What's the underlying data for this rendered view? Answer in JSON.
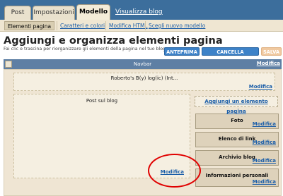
{
  "top_tabs": [
    {
      "label": "Post",
      "active": false
    },
    {
      "label": "Impostazioni",
      "active": false
    },
    {
      "label": "Modello",
      "active": true
    }
  ],
  "view_blog_link": "Visualizza blog",
  "sub_tabs": [
    {
      "label": "Elementi pagina",
      "active": true
    },
    {
      "label": "Caratteri e colori",
      "active": false
    },
    {
      "label": "Modifica HTML",
      "active": false
    },
    {
      "label": "Scegli nuovo modello",
      "active": false
    }
  ],
  "page": {
    "title": "Aggiungi e organizza elementi pagina",
    "subtitle": "Fai clic e trascina per riorganizzare gli elementi della pagina nel tuo blog."
  },
  "buttons": {
    "preview": "ANTEPRIMA",
    "clear": "CANCELLA MODIFICHE",
    "save": "SALVA"
  },
  "navbar": {
    "title": "Navbar",
    "edit": "Modifica"
  },
  "header_box": {
    "title": "Roberto's B(y) log(ic) (Int...",
    "edit": "Modifica"
  },
  "posts_box": {
    "title": "Post sul blog",
    "edit": "Modifica"
  },
  "add_gadget": "Aggiungi un elemento pagina",
  "gadgets": [
    {
      "title": "Foto",
      "edit": "Modifica"
    },
    {
      "title": "Elenco di link",
      "edit": "Modifica"
    },
    {
      "title": "Archivio blog",
      "edit": "Modifica"
    },
    {
      "title": "Informazioni personali",
      "edit": "Modifica"
    }
  ],
  "colors": {
    "topbar": "#3c6e9c",
    "accent_blue_button": "#3d82c8",
    "highlight_circle": "#e00000"
  }
}
